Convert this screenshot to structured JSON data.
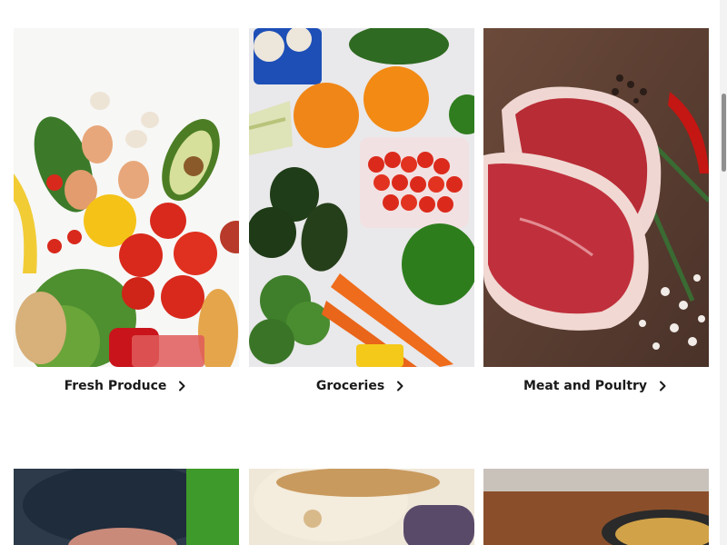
{
  "categories": [
    {
      "label": "Fresh Produce",
      "icon": "chevron-right-icon"
    },
    {
      "label": "Groceries",
      "icon": "chevron-right-icon"
    },
    {
      "label": "Meat and Poultry",
      "icon": "chevron-right-icon"
    }
  ],
  "colors": {
    "text": "#1a1a1a",
    "background": "#ffffff"
  }
}
